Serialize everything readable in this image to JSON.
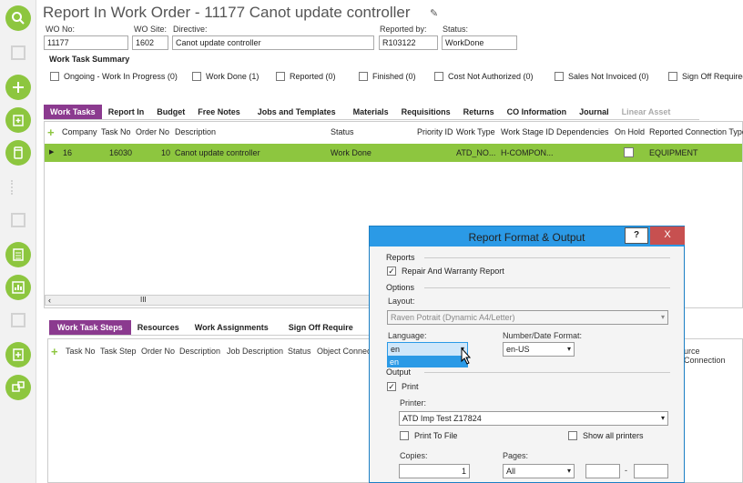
{
  "title": "Report In Work Order - 11177 Canot update controller",
  "fields": {
    "wo_no_label": "WO No:",
    "wo_no": "11177",
    "wo_site_label": "WO Site:",
    "wo_site": "1602",
    "directive_label": "Directive:",
    "directive": "Canot update controller",
    "reported_by_label": "Reported by:",
    "reported_by": "R103122",
    "status_label": "Status:",
    "status": "WorkDone"
  },
  "summary": {
    "title": "Work Task Summary",
    "items": [
      "Ongoing - Work In Progress (0)",
      "Work Done (1)",
      "Reported (0)",
      "Finished (0)",
      "Cost Not Authorized (0)",
      "Sales Not Invoiced (0)",
      "Sign Off Required"
    ]
  },
  "tabs": [
    "Work Tasks",
    "Report In",
    "Budget",
    "Free Notes",
    "Jobs and Templates",
    "Materials",
    "Requisitions",
    "Returns",
    "CO Information",
    "Journal",
    "Linear Asset"
  ],
  "grid": {
    "headers": [
      "Company",
      "Task No",
      "Order No",
      "Description",
      "Status",
      "Priority ID",
      "Work Type",
      "Work Stage ID",
      "Dependencies",
      "On Hold",
      "Reported Connection Type"
    ],
    "row": [
      "16",
      "16030",
      "10",
      "Canot update controller",
      "Work Done",
      "",
      "ATD_NO...",
      "H-COMPON...",
      "",
      "",
      "EQUIPMENT"
    ],
    "scroll_grip": "III"
  },
  "tabs2": [
    "Work Task Steps",
    "Resources",
    "Work Assignments",
    "Sign Off Require"
  ],
  "grid2": {
    "headers": [
      "Task No",
      "Task Step",
      "Order No",
      "Description",
      "Job Description",
      "Status",
      "Object Connec",
      "urce Connection"
    ]
  },
  "dialog": {
    "title": "Report Format & Output",
    "help": "?",
    "close": "X",
    "reports_section": "Reports",
    "repair_report": "Repair And Warranty Report",
    "options_section": "Options",
    "layout_label": "Layout:",
    "layout_value": "Raven Potrait (Dynamic A4/Letter)",
    "language_label": "Language:",
    "language_value": "en",
    "language_option": "en",
    "number_format_label": "Number/Date Format:",
    "number_format_value": "en-US",
    "output_section": "Output",
    "print_label": "Print",
    "printer_label": "Printer:",
    "printer_value": "ATD Imp Test Z17824",
    "print_to_file": "Print To File",
    "show_all_printers": "Show all printers",
    "copies_label": "Copies:",
    "copies_value": "1",
    "pages_label": "Pages:",
    "pages_value": "All",
    "pages_dash": "-"
  }
}
